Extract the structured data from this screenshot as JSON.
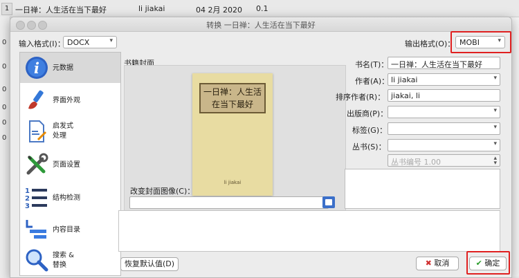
{
  "background_table": {
    "row_number": "1",
    "title_cell": "一日禅：人生活在当下最好",
    "author_cell": "li jiakai",
    "date_cell": "04 2月 2020",
    "rating_cell": "0.1",
    "left_row_numbers": [
      "0",
      "0",
      "0",
      "0",
      "0",
      "0"
    ]
  },
  "dialog": {
    "title": "转换 一日禅：人生活在当下最好",
    "input_format_label": "输入格式(I)：",
    "input_format_value": "DOCX",
    "output_format_label": "输出格式(O)：",
    "output_format_value": "MOBI"
  },
  "sidebar": {
    "items": [
      {
        "label": "元数据",
        "icon": "info-icon"
      },
      {
        "label": "界面外观",
        "icon": "brush-icon"
      },
      {
        "label": "启发式处理",
        "label_line1": "启发式",
        "label_line2": "处理",
        "icon": "document-wand-icon"
      },
      {
        "label": "页面设置",
        "icon": "wrench-screwdriver-icon"
      },
      {
        "label": "结构检测",
        "icon": "numbered-list-icon"
      },
      {
        "label": "内容目录",
        "icon": "toc-icon"
      },
      {
        "label": "搜索 & 替换",
        "label_line1": "搜索 &",
        "label_line2": "替换",
        "icon": "magnifier-icon"
      }
    ]
  },
  "cover": {
    "section_label": "书籍封面",
    "book_title_line1": "一日禅：人生活",
    "book_title_line2": "在当下最好",
    "book_author": "li jiakai",
    "change_cover_label": "改变封面图像(C)："
  },
  "metadata": {
    "title_label": "书名(T)：",
    "title_value": "一日禅：人生活在当下最好",
    "author_label": "作者(A)：",
    "author_value": "li jiakai",
    "author_sort_label": "排序作者(R)：",
    "author_sort_value": "jiakai, li",
    "publisher_label": "出版商(P)：",
    "publisher_value": "",
    "tags_label": "标签(G)：",
    "tags_value": "",
    "series_label": "丛书(S)：",
    "series_value": "",
    "series_number_placeholder": "丛书编号 1.00"
  },
  "buttons": {
    "restore_defaults": "恢复默认值(D)",
    "cancel": "取消",
    "ok": "确定"
  },
  "colors": {
    "highlight": "#e02020",
    "ok_check": "#2a9d2a",
    "cancel_x": "#d03030"
  }
}
